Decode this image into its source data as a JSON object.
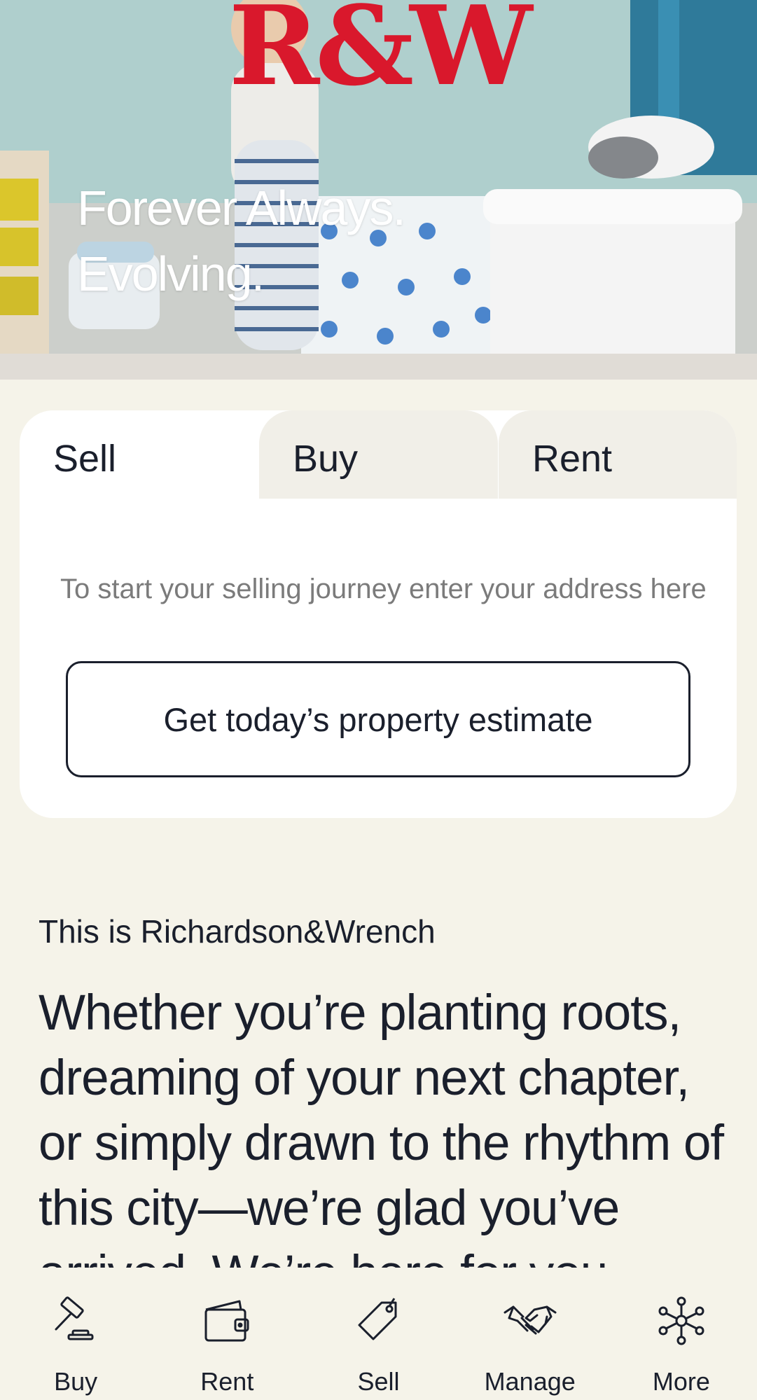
{
  "brand": {
    "logo_text": "R&W",
    "logo_color": "#d9182c"
  },
  "hero": {
    "tagline_line1": "Forever Always.",
    "tagline_line2": "Evolving."
  },
  "search": {
    "tabs": [
      {
        "label": "Sell",
        "active": true
      },
      {
        "label": "Buy",
        "active": false
      },
      {
        "label": "Rent",
        "active": false
      }
    ],
    "address_placeholder": "To start your selling journey enter your address here",
    "estimate_button_label": "Get today’s property estimate"
  },
  "about": {
    "eyebrow": "This is Richardson&Wrench",
    "body": "Whether you’re planting roots, dreaming of your next chapter, or simply drawn to the rhythm of this city—we’re glad you’ve arrived. We’re here for you."
  },
  "bottom_nav": {
    "items": [
      {
        "label": "Buy",
        "icon": "gavel-icon"
      },
      {
        "label": "Rent",
        "icon": "wallet-icon"
      },
      {
        "label": "Sell",
        "icon": "price-tag-icon"
      },
      {
        "label": "Manage",
        "icon": "handshake-icon"
      },
      {
        "label": "More",
        "icon": "network-icon"
      }
    ]
  }
}
